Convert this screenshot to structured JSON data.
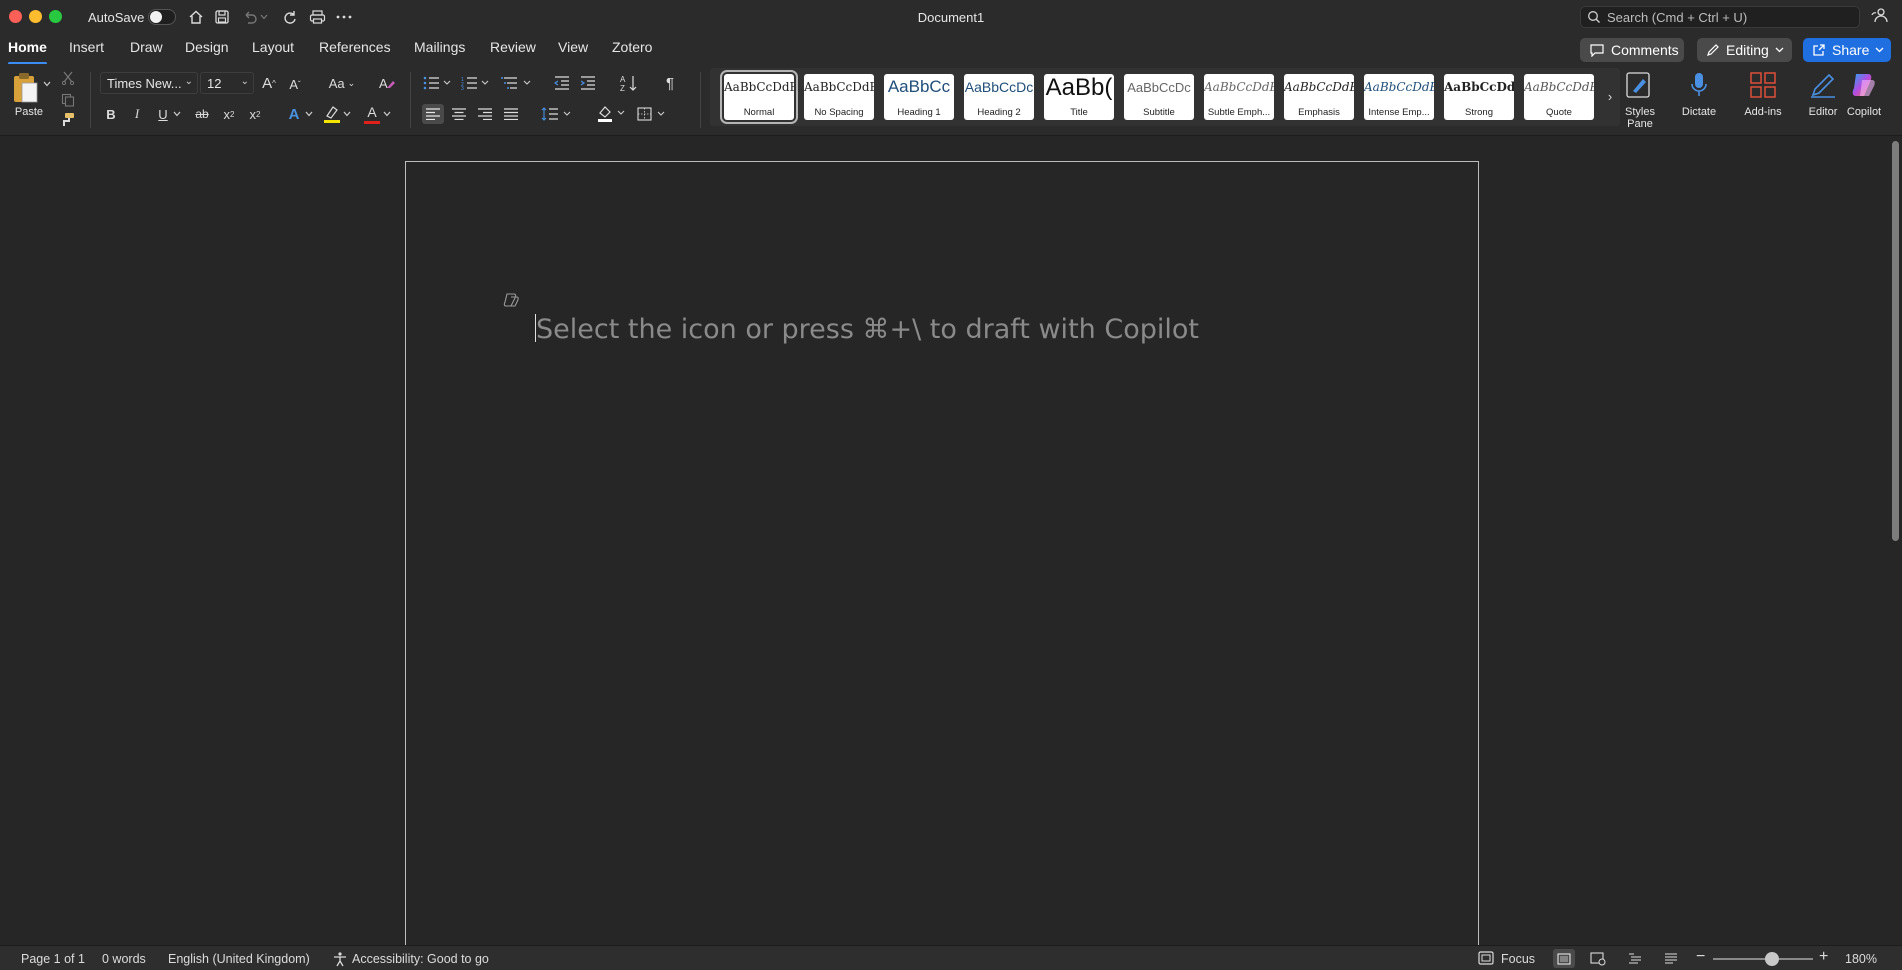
{
  "window": {
    "title": "Document1",
    "autosave_label": "AutoSave",
    "autosave_on": false
  },
  "search": {
    "placeholder": "Search (Cmd + Ctrl + U)"
  },
  "tabs": [
    {
      "label": "Home",
      "active": true
    },
    {
      "label": "Insert"
    },
    {
      "label": "Draw"
    },
    {
      "label": "Design"
    },
    {
      "label": "Layout"
    },
    {
      "label": "References"
    },
    {
      "label": "Mailings"
    },
    {
      "label": "Review"
    },
    {
      "label": "View"
    },
    {
      "label": "Zotero"
    }
  ],
  "header_buttons": {
    "comments": "Comments",
    "editing": "Editing",
    "share": "Share"
  },
  "ribbon": {
    "paste_label": "Paste",
    "font_name": "Times New...",
    "font_size": "12",
    "change_case": "Aa",
    "bold": "B",
    "italic": "I",
    "underline": "U",
    "strikethrough": "ab",
    "subscript": "x",
    "superscript": "x",
    "grow_font": "A",
    "shrink_font": "A",
    "text_effects": "A",
    "font_color": "A",
    "pilcrow": "¶",
    "styles": [
      {
        "sample": "AaBbCcDdEe",
        "name": "Normal",
        "selected": true
      },
      {
        "sample": "AaBbCcDdEe",
        "name": "No Spacing"
      },
      {
        "sample": "AaBbCc",
        "name": "Heading 1"
      },
      {
        "sample": "AaBbCcDc",
        "name": "Heading 2"
      },
      {
        "sample": "AaBb(",
        "name": "Title"
      },
      {
        "sample": "AaBbCcDc",
        "name": "Subtitle"
      },
      {
        "sample": "AaBbCcDdEe",
        "name": "Subtle Emph..."
      },
      {
        "sample": "AaBbCcDdEe",
        "name": "Emphasis"
      },
      {
        "sample": "AaBbCcDdEe",
        "name": "Intense Emp..."
      },
      {
        "sample": "AaBbCcDdI",
        "name": "Strong"
      },
      {
        "sample": "AaBbCcDdEe",
        "name": "Quote"
      }
    ],
    "styles_pane": "Styles Pane",
    "dictate": "Dictate",
    "add_ins": "Add-ins",
    "editor": "Editor",
    "copilot": "Copilot",
    "colors": {
      "highlight": "#f5e400",
      "font_color": "#e0201b",
      "accent": "#3b8cf5"
    }
  },
  "document": {
    "placeholder": "Select the icon or press ⌘+\\ to draft with Copilot"
  },
  "status": {
    "page": "Page 1 of 1",
    "words": "0 words",
    "language": "English (United Kingdom)",
    "accessibility": "Accessibility: Good to go",
    "focus": "Focus",
    "zoom": "180%",
    "zoom_fraction": 0.59
  }
}
